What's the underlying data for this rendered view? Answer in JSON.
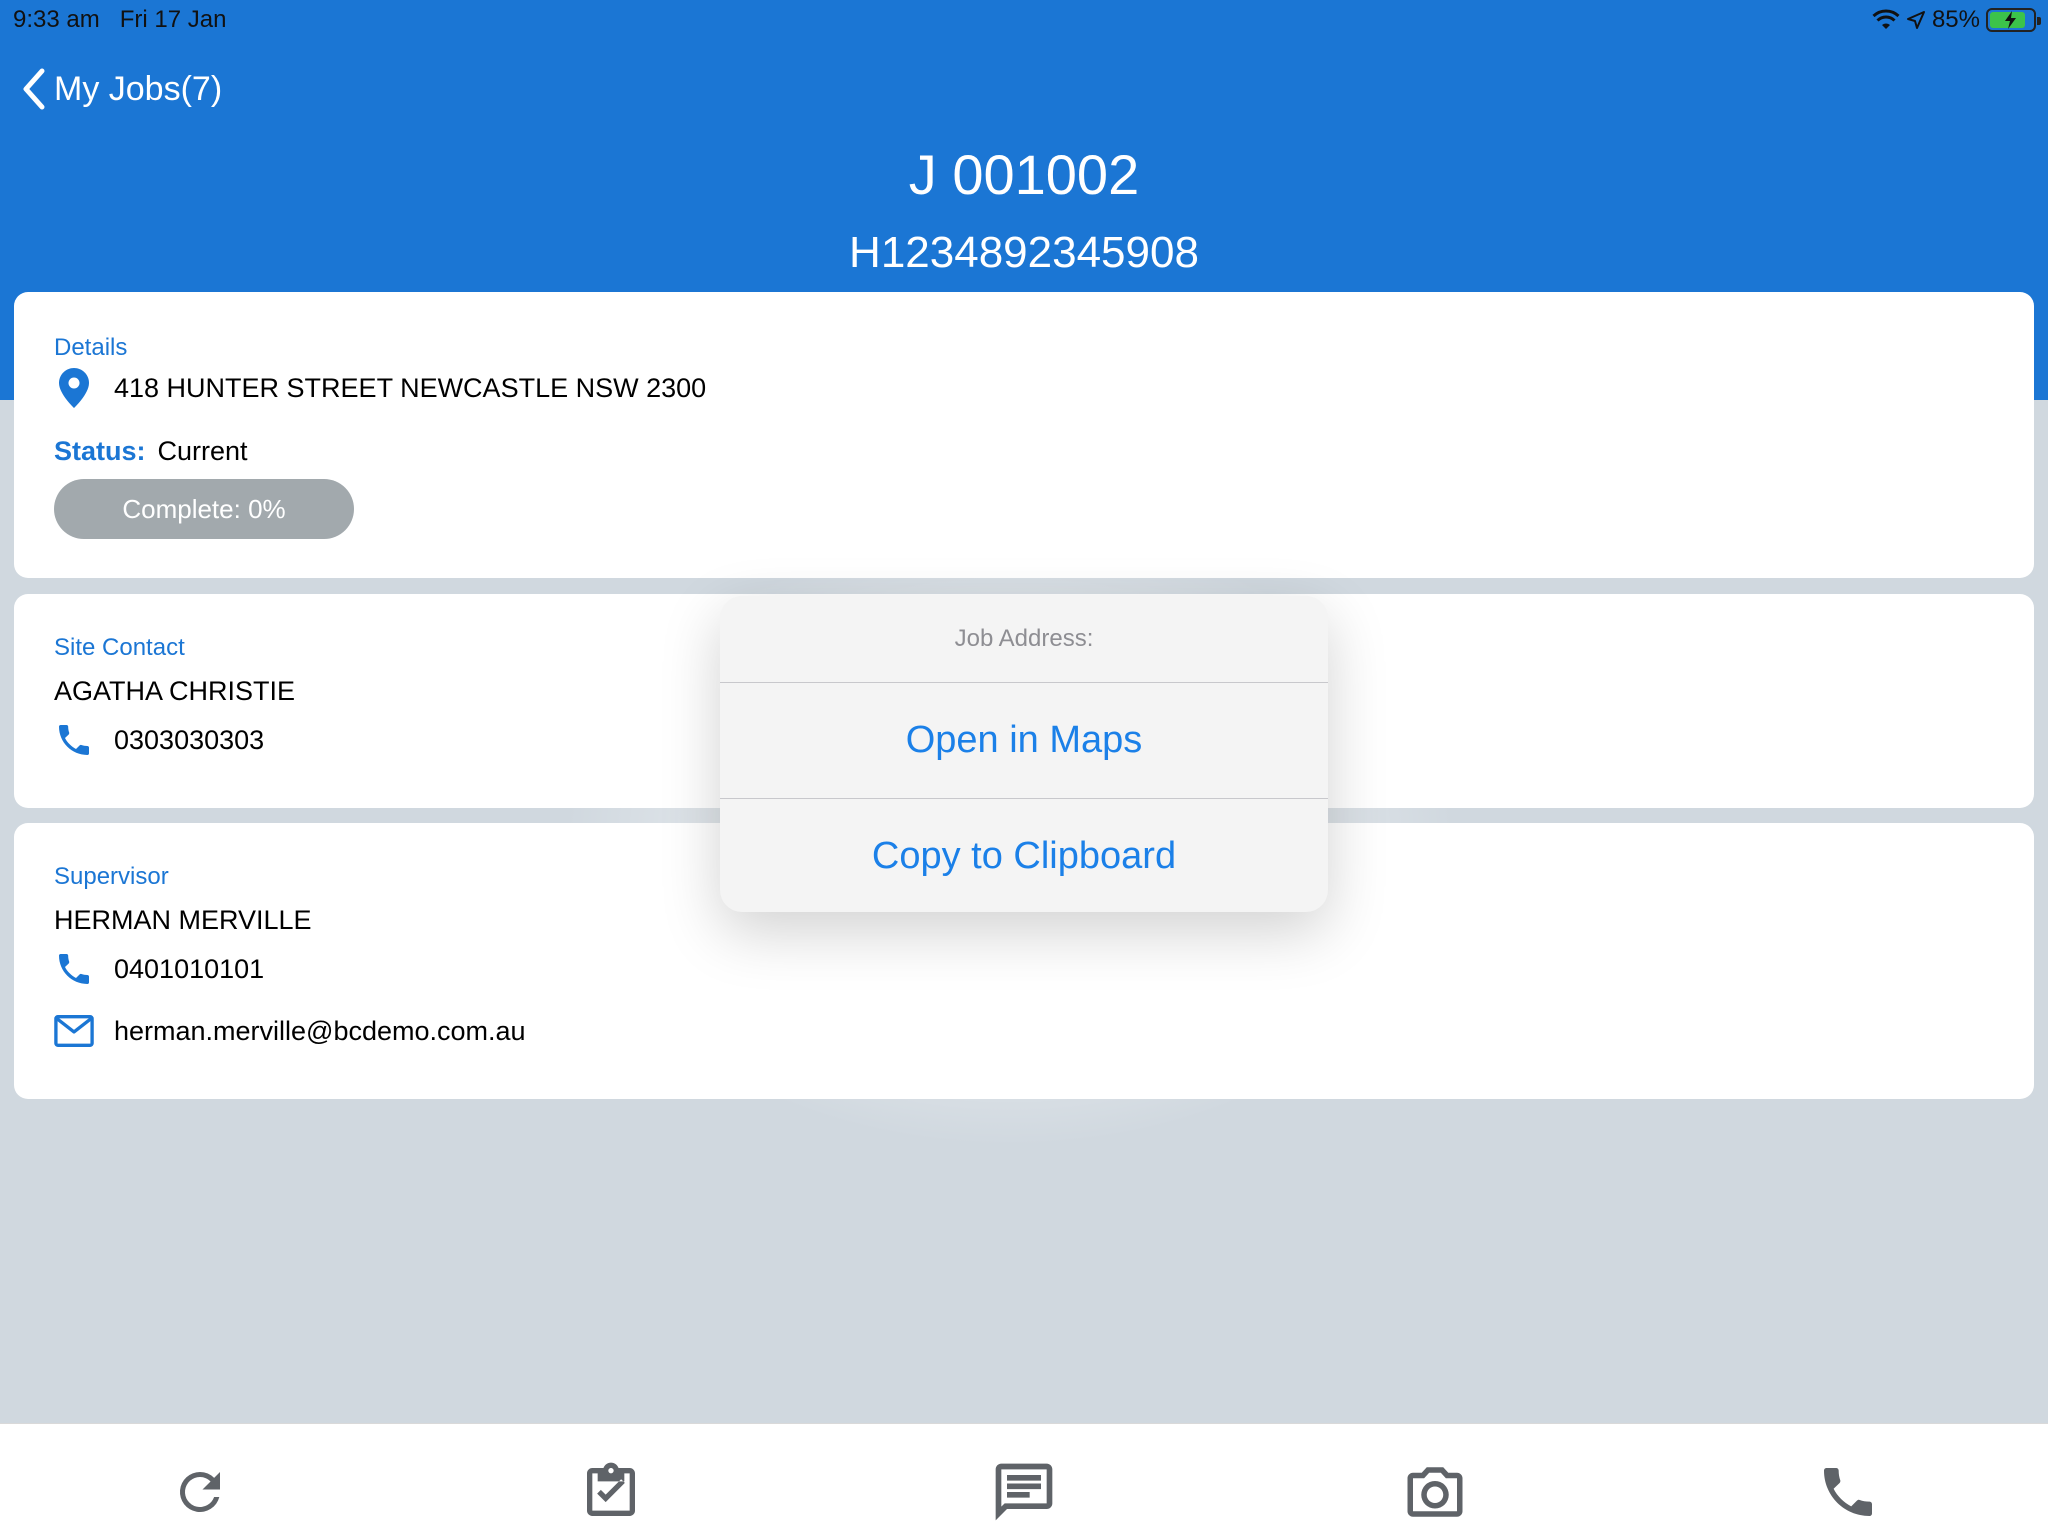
{
  "status_bar": {
    "time": "9:33 am",
    "date": "Fri 17 Jan",
    "battery": "85%",
    "battery_level": 0.85,
    "icons": [
      "wifi-icon",
      "location-icon",
      "battery-icon"
    ]
  },
  "nav": {
    "back_label": "My Jobs(7)",
    "job_number": "J 001002",
    "job_reference": "H1234892345908"
  },
  "details": {
    "section_label": "Details",
    "address": "418 HUNTER STREET NEWCASTLE NSW 2300",
    "status_label": "Status:",
    "status_value": "Current",
    "progress_label": "Complete: 0%",
    "progress_value": 0
  },
  "site_contact": {
    "section_label": "Site Contact",
    "name": "AGATHA CHRISTIE",
    "phone": "0303030303"
  },
  "supervisor": {
    "section_label": "Supervisor",
    "name": "HERMAN MERVILLE",
    "phone": "0401010101",
    "email": "herman.merville@bcdemo.com.au"
  },
  "action_sheet": {
    "title": "Job Address:",
    "open_maps": "Open in Maps",
    "copy_clipboard": "Copy to Clipboard"
  },
  "tabbar": {
    "items": [
      "refresh-icon",
      "clipboard-check-icon",
      "message-icon",
      "camera-icon",
      "phone-icon"
    ]
  },
  "colors": {
    "accent": "#1b76d4",
    "background": "#d0d8df",
    "sheet_button": "#1b80e8",
    "tab_icon": "#5f6368"
  }
}
